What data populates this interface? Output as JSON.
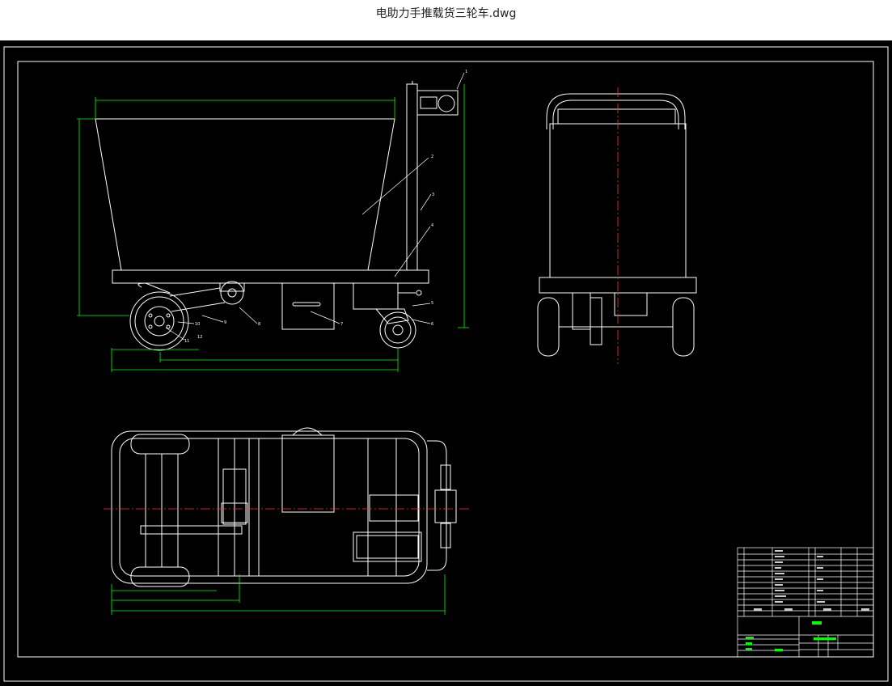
{
  "app": {
    "file_title": "电助力手推载货三轮车.dwg"
  },
  "drawing": {
    "part_labels": [
      "1",
      "2",
      "3",
      "4",
      "5",
      "6",
      "7",
      "8",
      "9",
      "10",
      "11",
      "12"
    ]
  },
  "colors": {
    "background": "#000000",
    "linework": "#ffffff",
    "dimension": "#00ff00",
    "centerline": "#ff3030",
    "leader": "#ffffff",
    "title_text": "#00ff00"
  }
}
